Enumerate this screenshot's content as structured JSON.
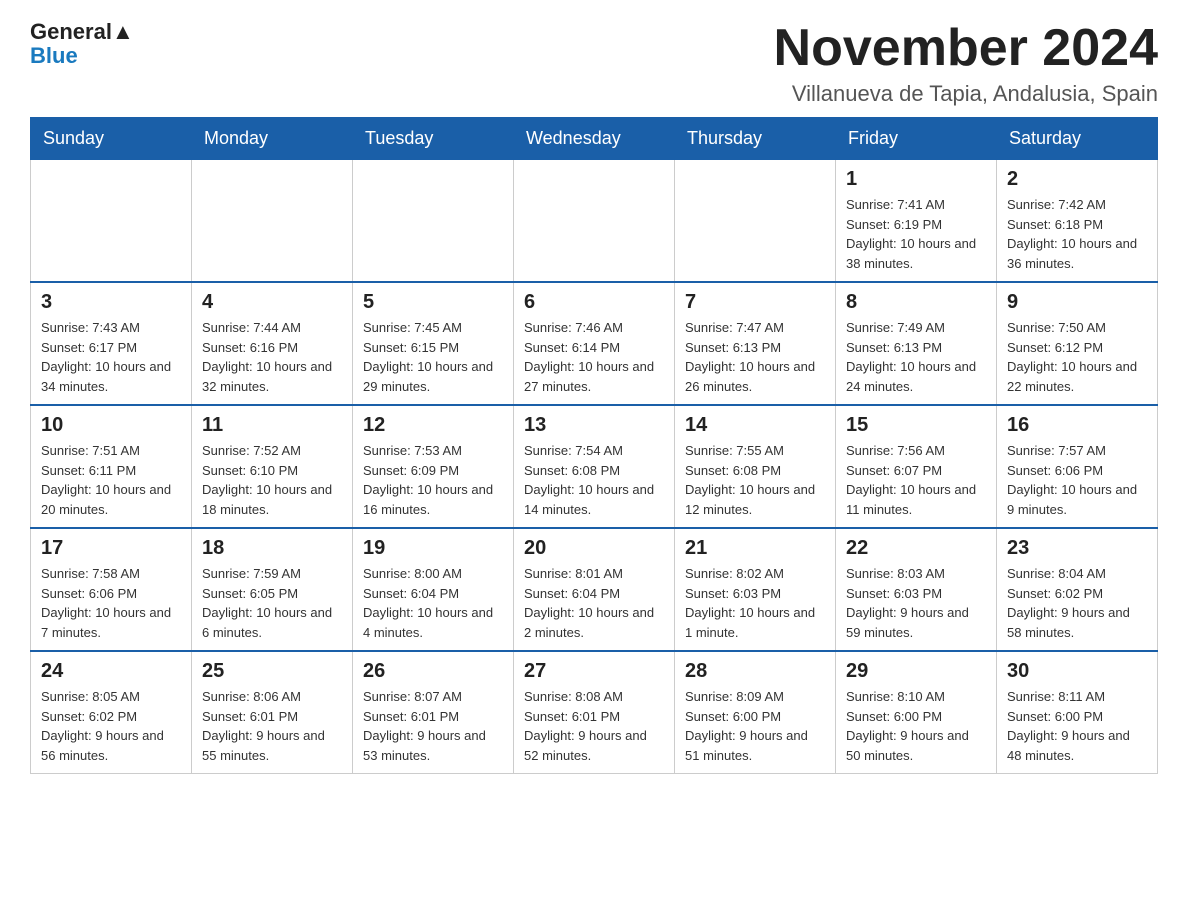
{
  "header": {
    "logo_general": "General",
    "logo_blue": "Blue",
    "month_title": "November 2024",
    "location": "Villanueva de Tapia, Andalusia, Spain"
  },
  "weekdays": [
    "Sunday",
    "Monday",
    "Tuesday",
    "Wednesday",
    "Thursday",
    "Friday",
    "Saturday"
  ],
  "weeks": [
    [
      {
        "day": "",
        "info": ""
      },
      {
        "day": "",
        "info": ""
      },
      {
        "day": "",
        "info": ""
      },
      {
        "day": "",
        "info": ""
      },
      {
        "day": "",
        "info": ""
      },
      {
        "day": "1",
        "info": "Sunrise: 7:41 AM\nSunset: 6:19 PM\nDaylight: 10 hours and 38 minutes."
      },
      {
        "day": "2",
        "info": "Sunrise: 7:42 AM\nSunset: 6:18 PM\nDaylight: 10 hours and 36 minutes."
      }
    ],
    [
      {
        "day": "3",
        "info": "Sunrise: 7:43 AM\nSunset: 6:17 PM\nDaylight: 10 hours and 34 minutes."
      },
      {
        "day": "4",
        "info": "Sunrise: 7:44 AM\nSunset: 6:16 PM\nDaylight: 10 hours and 32 minutes."
      },
      {
        "day": "5",
        "info": "Sunrise: 7:45 AM\nSunset: 6:15 PM\nDaylight: 10 hours and 29 minutes."
      },
      {
        "day": "6",
        "info": "Sunrise: 7:46 AM\nSunset: 6:14 PM\nDaylight: 10 hours and 27 minutes."
      },
      {
        "day": "7",
        "info": "Sunrise: 7:47 AM\nSunset: 6:13 PM\nDaylight: 10 hours and 26 minutes."
      },
      {
        "day": "8",
        "info": "Sunrise: 7:49 AM\nSunset: 6:13 PM\nDaylight: 10 hours and 24 minutes."
      },
      {
        "day": "9",
        "info": "Sunrise: 7:50 AM\nSunset: 6:12 PM\nDaylight: 10 hours and 22 minutes."
      }
    ],
    [
      {
        "day": "10",
        "info": "Sunrise: 7:51 AM\nSunset: 6:11 PM\nDaylight: 10 hours and 20 minutes."
      },
      {
        "day": "11",
        "info": "Sunrise: 7:52 AM\nSunset: 6:10 PM\nDaylight: 10 hours and 18 minutes."
      },
      {
        "day": "12",
        "info": "Sunrise: 7:53 AM\nSunset: 6:09 PM\nDaylight: 10 hours and 16 minutes."
      },
      {
        "day": "13",
        "info": "Sunrise: 7:54 AM\nSunset: 6:08 PM\nDaylight: 10 hours and 14 minutes."
      },
      {
        "day": "14",
        "info": "Sunrise: 7:55 AM\nSunset: 6:08 PM\nDaylight: 10 hours and 12 minutes."
      },
      {
        "day": "15",
        "info": "Sunrise: 7:56 AM\nSunset: 6:07 PM\nDaylight: 10 hours and 11 minutes."
      },
      {
        "day": "16",
        "info": "Sunrise: 7:57 AM\nSunset: 6:06 PM\nDaylight: 10 hours and 9 minutes."
      }
    ],
    [
      {
        "day": "17",
        "info": "Sunrise: 7:58 AM\nSunset: 6:06 PM\nDaylight: 10 hours and 7 minutes."
      },
      {
        "day": "18",
        "info": "Sunrise: 7:59 AM\nSunset: 6:05 PM\nDaylight: 10 hours and 6 minutes."
      },
      {
        "day": "19",
        "info": "Sunrise: 8:00 AM\nSunset: 6:04 PM\nDaylight: 10 hours and 4 minutes."
      },
      {
        "day": "20",
        "info": "Sunrise: 8:01 AM\nSunset: 6:04 PM\nDaylight: 10 hours and 2 minutes."
      },
      {
        "day": "21",
        "info": "Sunrise: 8:02 AM\nSunset: 6:03 PM\nDaylight: 10 hours and 1 minute."
      },
      {
        "day": "22",
        "info": "Sunrise: 8:03 AM\nSunset: 6:03 PM\nDaylight: 9 hours and 59 minutes."
      },
      {
        "day": "23",
        "info": "Sunrise: 8:04 AM\nSunset: 6:02 PM\nDaylight: 9 hours and 58 minutes."
      }
    ],
    [
      {
        "day": "24",
        "info": "Sunrise: 8:05 AM\nSunset: 6:02 PM\nDaylight: 9 hours and 56 minutes."
      },
      {
        "day": "25",
        "info": "Sunrise: 8:06 AM\nSunset: 6:01 PM\nDaylight: 9 hours and 55 minutes."
      },
      {
        "day": "26",
        "info": "Sunrise: 8:07 AM\nSunset: 6:01 PM\nDaylight: 9 hours and 53 minutes."
      },
      {
        "day": "27",
        "info": "Sunrise: 8:08 AM\nSunset: 6:01 PM\nDaylight: 9 hours and 52 minutes."
      },
      {
        "day": "28",
        "info": "Sunrise: 8:09 AM\nSunset: 6:00 PM\nDaylight: 9 hours and 51 minutes."
      },
      {
        "day": "29",
        "info": "Sunrise: 8:10 AM\nSunset: 6:00 PM\nDaylight: 9 hours and 50 minutes."
      },
      {
        "day": "30",
        "info": "Sunrise: 8:11 AM\nSunset: 6:00 PM\nDaylight: 9 hours and 48 minutes."
      }
    ]
  ]
}
